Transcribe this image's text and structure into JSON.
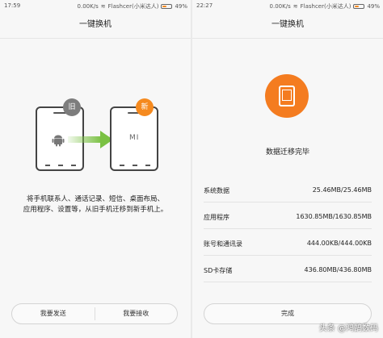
{
  "left_screen": {
    "status": {
      "time": "17:59",
      "speed": "0.00K/s",
      "carrier": "Flashcer(小米达人)",
      "battery": "49%",
      "battery_level": 0.49
    },
    "title": "一键换机",
    "old_badge": "旧",
    "new_badge": "新",
    "new_phone_logo": "MI",
    "description_line1": "将手机联系人、通话记录、短信、桌面布局、",
    "description_line2": "应用程序、设置等，从旧手机迁移到新手机上。",
    "send_button": "我要发送",
    "receive_button": "我要接收"
  },
  "right_screen": {
    "status": {
      "time": "22:27",
      "speed": "0.00K/s",
      "carrier": "Flashcer(小米达人)",
      "battery": "49%",
      "battery_level": 0.49
    },
    "title": "一键换机",
    "done_title": "数据迁移完毕",
    "rows": [
      {
        "name": "系统数据",
        "value": "25.46MB/25.46MB"
      },
      {
        "name": "应用程序",
        "value": "1630.85MB/1630.85MB"
      },
      {
        "name": "账号和通讯录",
        "value": "444.00KB/444.00KB"
      },
      {
        "name": "SD卡存储",
        "value": "436.80MB/436.80MB"
      }
    ],
    "finish_button": "完成"
  },
  "watermark": "头条 @鸿鹄数码",
  "colors": {
    "accent": "#f47c20",
    "old_badge": "#7d7d7d",
    "arrow": "#7ac143"
  }
}
